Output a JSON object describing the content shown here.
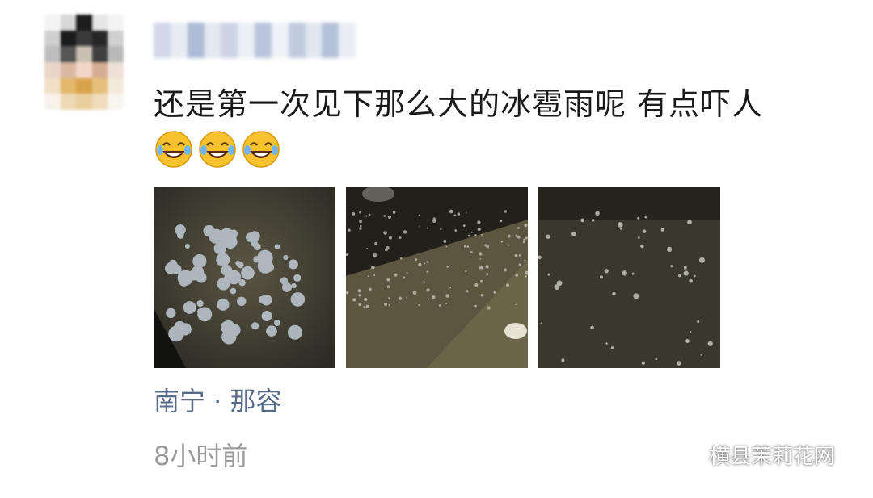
{
  "post": {
    "text": "还是第一次见下那么大的冰雹雨呢 有点吓人",
    "emojis": [
      "laughing-tears-emoji",
      "laughing-tears-emoji",
      "laughing-tears-emoji"
    ],
    "location": "南宁 · 那容",
    "time": "8小时前"
  },
  "watermark": {
    "text": "横县茉莉花网",
    "icon": "wechat-icon"
  },
  "colors": {
    "location": "#586b8c",
    "time": "#9a9a9a",
    "text": "#1a1a1a"
  }
}
